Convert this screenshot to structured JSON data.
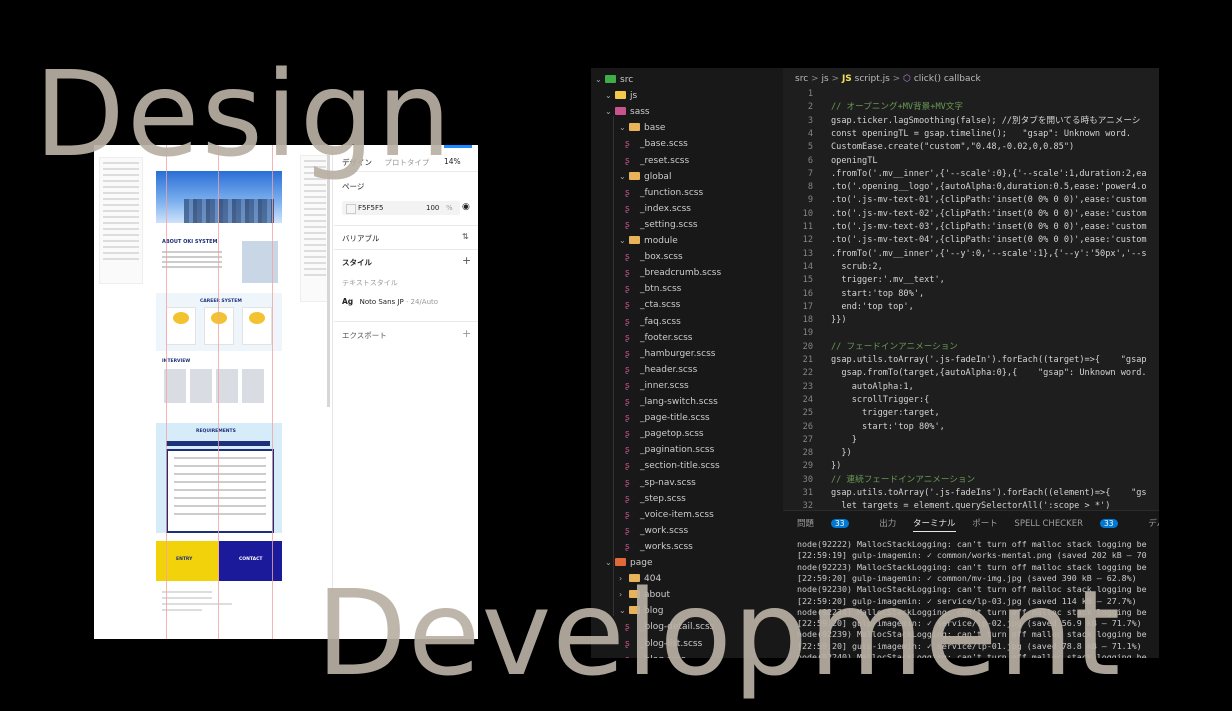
{
  "overlay": {
    "design": "Design",
    "development": "Development"
  },
  "figma": {
    "tab_design": "デザイン",
    "tab_prototype": "プロトタイプ",
    "zoom": "14%",
    "page_label": "ページ",
    "page_color": "F5F5F5",
    "page_opacity": "100",
    "percent": "%",
    "variables": "バリアブル",
    "styles": "スタイル",
    "text_styles": "テキストスタイル",
    "font_name": "Noto Sans JP",
    "font_size": "· 24/Auto",
    "export": "エクスポート",
    "ag": "Ag",
    "lp": {
      "about": "ABOUT OKI SYSTEM",
      "career": "CAREER SYSTEM",
      "interview": "INTERVIEW",
      "requirements": "REQUIREMENTS",
      "entry": "ENTRY",
      "contact": "CONTACT"
    }
  },
  "vscode": {
    "tree": [
      {
        "label": "src",
        "type": "folder-open",
        "depth": 0,
        "color": "#3fae49"
      },
      {
        "label": "js",
        "type": "folder-open",
        "depth": 1,
        "color": "#f1c84b"
      },
      {
        "label": "sass",
        "type": "folder-open",
        "depth": 1,
        "color": "#c6538c"
      },
      {
        "label": "base",
        "type": "folder-open",
        "depth": 2,
        "color": "#e7b25a"
      },
      {
        "label": "_base.scss",
        "type": "sass",
        "depth": 3
      },
      {
        "label": "_reset.scss",
        "type": "sass",
        "depth": 3
      },
      {
        "label": "global",
        "type": "folder-open",
        "depth": 2,
        "color": "#e7b25a"
      },
      {
        "label": "_function.scss",
        "type": "sass",
        "depth": 3
      },
      {
        "label": "_index.scss",
        "type": "sass",
        "depth": 3
      },
      {
        "label": "_setting.scss",
        "type": "sass",
        "depth": 3
      },
      {
        "label": "module",
        "type": "folder-open",
        "depth": 2,
        "color": "#e7b25a"
      },
      {
        "label": "_box.scss",
        "type": "sass",
        "depth": 3
      },
      {
        "label": "_breadcrumb.scss",
        "type": "sass",
        "depth": 3
      },
      {
        "label": "_btn.scss",
        "type": "sass",
        "depth": 3
      },
      {
        "label": "_cta.scss",
        "type": "sass",
        "depth": 3
      },
      {
        "label": "_faq.scss",
        "type": "sass",
        "depth": 3
      },
      {
        "label": "_footer.scss",
        "type": "sass",
        "depth": 3
      },
      {
        "label": "_hamburger.scss",
        "type": "sass",
        "depth": 3
      },
      {
        "label": "_header.scss",
        "type": "sass",
        "depth": 3
      },
      {
        "label": "_inner.scss",
        "type": "sass",
        "depth": 3
      },
      {
        "label": "_lang-switch.scss",
        "type": "sass",
        "depth": 3
      },
      {
        "label": "_page-title.scss",
        "type": "sass",
        "depth": 3
      },
      {
        "label": "_pagetop.scss",
        "type": "sass",
        "depth": 3
      },
      {
        "label": "_pagination.scss",
        "type": "sass",
        "depth": 3
      },
      {
        "label": "_section-title.scss",
        "type": "sass",
        "depth": 3
      },
      {
        "label": "_sp-nav.scss",
        "type": "sass",
        "depth": 3
      },
      {
        "label": "_step.scss",
        "type": "sass",
        "depth": 3
      },
      {
        "label": "_voice-item.scss",
        "type": "sass",
        "depth": 3
      },
      {
        "label": "_work.scss",
        "type": "sass",
        "depth": 3
      },
      {
        "label": "_works.scss",
        "type": "sass",
        "depth": 3
      },
      {
        "label": "page",
        "type": "folder-open",
        "depth": 1,
        "color": "#e0693a"
      },
      {
        "label": "404",
        "type": "folder",
        "depth": 2,
        "color": "#e7b25a"
      },
      {
        "label": "about",
        "type": "folder",
        "depth": 2,
        "color": "#e7b25a"
      },
      {
        "label": "blog",
        "type": "folder-open",
        "depth": 2,
        "color": "#e7b25a"
      },
      {
        "label": "_blog-detail.scss",
        "type": "sass",
        "depth": 3
      },
      {
        "label": "_blog-list.scss",
        "type": "sass",
        "depth": 3
      },
      {
        "label": "_blog.scss",
        "type": "sass",
        "depth": 3
      }
    ],
    "breadcrumb": {
      "p1": "src",
      "p2": "js",
      "js": "JS",
      "file": "script.js",
      "fn": "click() callback",
      "sep": ">"
    },
    "code": [
      {
        "n": "1",
        "t": ""
      },
      {
        "n": "2",
        "t": "// オープニング+MV背景+MV文字",
        "c": true
      },
      {
        "n": "3",
        "t": "gsap.ticker.lagSmoothing(false); //別タブを開いてる時もアニメーシ"
      },
      {
        "n": "4",
        "t": "const openingTL = gsap.timeline();   \"gsap\": Unknown word."
      },
      {
        "n": "5",
        "t": "CustomEase.create(\"custom\",\"0.48,-0.02,0,0.85\")"
      },
      {
        "n": "6",
        "t": "openingTL"
      },
      {
        "n": "7",
        "t": ".fromTo('.mv__inner',{'--scale':0},{'--scale':1,duration:2,ea"
      },
      {
        "n": "8",
        "t": ".to('.opening__logo',{autoAlpha:0,duration:0.5,ease:'power4.o"
      },
      {
        "n": "9",
        "t": ".to('.js-mv-text-01',{clipPath:'inset(0 0% 0 0)',ease:'custom"
      },
      {
        "n": "10",
        "t": ".to('.js-mv-text-02',{clipPath:'inset(0 0% 0 0)',ease:'custom"
      },
      {
        "n": "11",
        "t": ".to('.js-mv-text-03',{clipPath:'inset(0 0% 0 0)',ease:'custom"
      },
      {
        "n": "12",
        "t": ".to('.js-mv-text-04',{clipPath:'inset(0 0% 0 0)',ease:'custom"
      },
      {
        "n": "13",
        "t": ".fromTo('.mv__inner',{'--y':0,'--scale':1},{'--y':'50px','--s"
      },
      {
        "n": "14",
        "t": "  scrub:2,"
      },
      {
        "n": "15",
        "t": "  trigger:'.mv__text',"
      },
      {
        "n": "16",
        "t": "  start:'top 80%',"
      },
      {
        "n": "17",
        "t": "  end:'top top',"
      },
      {
        "n": "18",
        "t": "}})"
      },
      {
        "n": "19",
        "t": ""
      },
      {
        "n": "20",
        "t": "// フェードインアニメーション",
        "c": true
      },
      {
        "n": "21",
        "t": "gsap.utils.toArray('.js-fadeIn').forEach((target)=>{    \"gsap"
      },
      {
        "n": "22",
        "t": "  gsap.fromTo(target,{autoAlpha:0},{    \"gsap\": Unknown word."
      },
      {
        "n": "23",
        "t": "    autoAlpha:1,"
      },
      {
        "n": "24",
        "t": "    scrollTrigger:{"
      },
      {
        "n": "25",
        "t": "      trigger:target,"
      },
      {
        "n": "26",
        "t": "      start:'top 80%',"
      },
      {
        "n": "27",
        "t": "    }"
      },
      {
        "n": "28",
        "t": "  })"
      },
      {
        "n": "29",
        "t": "})"
      },
      {
        "n": "30",
        "t": "// 連続フェードインアニメーション",
        "c": true
      },
      {
        "n": "31",
        "t": "gsap.utils.toArray('.js-fadeIns').forEach((element)=>{    \"gs"
      },
      {
        "n": "32",
        "t": "  let targets = element.querySelectorAll(':scope > *')"
      }
    ],
    "panel_tabs": {
      "problems": "問題",
      "problems_count": "33",
      "output": "出力",
      "terminal": "ターミナル",
      "ports": "ポート",
      "spell": "SPELL CHECKER",
      "spell_count": "33",
      "debug": "デバッグ コンソール"
    },
    "terminal": [
      "node(92222) MallocStackLogging: can't turn off malloc stack logging be",
      "[22:59:19] gulp-imagemin: ✓ common/works-mental.png (saved 202 kB – 70",
      "node(92223) MallocStackLogging: can't turn off malloc stack logging be",
      "[22:59:20] gulp-imagemin: ✓ common/mv-img.jpg (saved 390 kB – 62.8%)",
      "node(92230) MallocStackLogging: can't turn off malloc stack logging be",
      "[22:59:20] gulp-imagemin: ✓ service/lp-03.jpg (saved 114 kB – 27.7%)",
      "node(92234) MallocStackLogging: can't turn off malloc stack logging be",
      "[22:59:20] gulp-imagemin: ✓ service/lp-02.jpg (saved 56.9 kB – 71.7%)",
      "node(92239) MallocStackLogging: can't turn off malloc stack logging be",
      "[22:59:20] gulp-imagemin: ✓ service/lp-01.jpg (saved 78.8 kB – 71.1%)",
      "node(92240) MallocStackLogging: can't turn off malloc stack logging be"
    ]
  }
}
